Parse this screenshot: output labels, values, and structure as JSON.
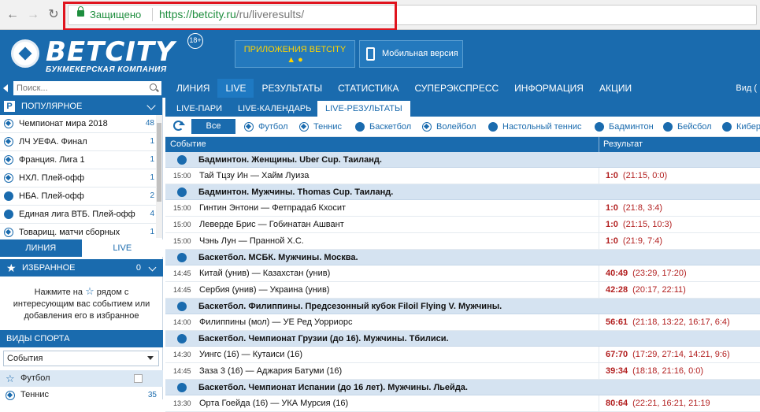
{
  "browser": {
    "secure_label": "Защищено",
    "url_host": "https://betcity.ru",
    "url_path": "/ru/liveresults/"
  },
  "header": {
    "logo": "BETCITY",
    "logo_sub": "БУКМЕКЕРСКАЯ КОМПАНИЯ",
    "age": "18+",
    "apps_label": "ПРИЛОЖЕНИЯ BETCITY",
    "mobile_label": "Мобильная версия"
  },
  "search": {
    "placeholder": "Поиск..."
  },
  "nav": {
    "items": [
      "ЛИНИЯ",
      "LIVE",
      "РЕЗУЛЬТАТЫ",
      "СТАТИСТИКА",
      "СУПЕРЭКСПРЕСС",
      "ИНФОРМАЦИЯ",
      "АКЦИИ"
    ],
    "right": "Вид ("
  },
  "sidebar": {
    "popular_badge": "P",
    "popular_title": "ПОПУЛЯРНОЕ",
    "popular": [
      {
        "label": "Чемпионат мира 2018",
        "count": "48"
      },
      {
        "label": "ЛЧ УЕФА. Финал",
        "count": "1"
      },
      {
        "label": "Франция. Лига 1",
        "count": "1"
      },
      {
        "label": "НХЛ. Плей-офф",
        "count": "1"
      },
      {
        "label": "НБА. Плей-офф",
        "count": "2"
      },
      {
        "label": "Единая лига ВТБ. Плей-офф",
        "count": "4"
      },
      {
        "label": "Товарищ. матчи сборных",
        "count": "1"
      }
    ],
    "tab_line": "ЛИНИЯ",
    "tab_live": "LIVE",
    "fav_title": "ИЗБРАННОЕ",
    "fav_count": "0",
    "fav_note_1": "Нажмите на",
    "fav_note_2": "рядом с",
    "fav_note_3": "интересующим вас событием или",
    "fav_note_4": "добавления его в избранное",
    "sports_title": "ВИДЫ СПОРТА",
    "select_value": "События",
    "sports": [
      {
        "label": "Футбол",
        "count": ""
      },
      {
        "label": "Теннис",
        "count": "35"
      }
    ]
  },
  "content": {
    "subtabs": [
      "LIVE-ПАРИ",
      "LIVE-КАЛЕНДАРЬ",
      "LIVE-РЕЗУЛЬТАТЫ"
    ],
    "all_label": "Все",
    "filters": [
      "Футбол",
      "Теннис",
      "Баскетбол",
      "Волейбол",
      "Настольный теннис",
      "Бадминтон",
      "Бейсбол",
      "Кибер"
    ],
    "col_event": "Событие",
    "col_result": "Результат",
    "groups": [
      {
        "title": "Бадминтон. Женщины. Uber Cup. Таиланд.",
        "events": [
          {
            "time": "15:00",
            "name": "Тай Тцзу Ин  — Хайм Луиза",
            "score": "1:0",
            "details": "(21:15, 0:0)"
          }
        ]
      },
      {
        "title": "Бадминтон. Мужчины. Thomas Cup. Таиланд.",
        "events": [
          {
            "time": "15:00",
            "name": "Гинтин Энтони  — Фетпрадаб Кхосит",
            "score": "1:0",
            "details": "(21:8, 3:4)"
          },
          {
            "time": "15:00",
            "name": "Леверде Брис  — Гобинатан Ашвант",
            "score": "1:0",
            "details": "(21:15, 10:3)"
          },
          {
            "time": "15:00",
            "name": "Чэнь Лун  — Пранной Х.С.",
            "score": "1:0",
            "details": "(21:9, 7:4)"
          }
        ]
      },
      {
        "title": "Баскетбол. МСБК. Мужчины. Москва.",
        "events": [
          {
            "time": "14:45",
            "name": "Китай (унив)  — Казахстан (унив)",
            "score": "40:49",
            "details": "(23:29, 17:20)"
          },
          {
            "time": "14:45",
            "name": "Сербия (унив)  — Украина (унив)",
            "score": "42:28",
            "details": "(20:17, 22:11)"
          }
        ]
      },
      {
        "title": "Баскетбол. Филиппины. Предсезонный кубок Filoil Flying V. Мужчины.",
        "events": [
          {
            "time": "14:00",
            "name": "Филиппины (мол)  — УЕ Ред Уорриорс",
            "score": "56:61",
            "details": "(21:18, 13:22, 16:17, 6:4)"
          }
        ]
      },
      {
        "title": "Баскетбол. Чемпионат Грузии (до 16). Мужчины. Тбилиси.",
        "events": [
          {
            "time": "14:30",
            "name": "Уингс (16)  — Кутаиси (16)",
            "score": "67:70",
            "details": "(17:29, 27:14, 14:21, 9:6)"
          },
          {
            "time": "14:45",
            "name": "Заза 3 (16)  — Аджария Батуми (16)",
            "score": "39:34",
            "details": "(18:18, 21:16, 0:0)"
          }
        ]
      },
      {
        "title": "Баскетбол. Чемпионат Испании (до 16 лет). Мужчины. Льейда.",
        "events": [
          {
            "time": "13:30",
            "name": "Орта Гоейда (16)  — УКА Мурсия (16)",
            "score": "80:64",
            "details": "(22:21, 16:21, 21:19"
          }
        ]
      }
    ]
  },
  "colors": {
    "brand": "#1a6bae",
    "score": "#b21f1f",
    "secure": "#1e8e3e",
    "highlight": "#e0141e"
  }
}
